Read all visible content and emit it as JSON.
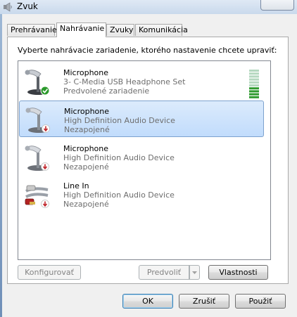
{
  "window": {
    "title": "Zvuk"
  },
  "tabs": [
    {
      "label": "Prehrávanie"
    },
    {
      "label": "Nahrávanie"
    },
    {
      "label": "Zvuky"
    },
    {
      "label": "Komunikácia"
    }
  ],
  "instruction": "Vyberte nahrávacie zariadenie, ktorého nastavenie chcete upraviť:",
  "devices": [
    {
      "name": "Microphone",
      "description": "3- C-Media USB Headphone Set",
      "status": "Predvolené zariadenie",
      "icon": "microphone-icon",
      "badge": "default-check-badge",
      "selected": false
    },
    {
      "name": "Microphone",
      "description": "High Definition Audio Device",
      "status": "Nezapojené",
      "icon": "microphone-icon",
      "badge": "unplugged-badge",
      "selected": true
    },
    {
      "name": "Microphone",
      "description": "High Definition Audio Device",
      "status": "Nezapojené",
      "icon": "microphone-icon",
      "badge": "unplugged-badge",
      "selected": false
    },
    {
      "name": "Line In",
      "description": "High Definition Audio Device",
      "status": "Nezapojené",
      "icon": "line-in-jack-icon",
      "badge": "unplugged-badge",
      "selected": false
    }
  ],
  "level_meter": {
    "segments_total": 10,
    "segments_lit": 4,
    "lit_color": "#2e9a2e",
    "unlit_color": "#b5d8c0"
  },
  "buttons": {
    "configure": "Konfigurovať",
    "set_default": "Predvoliť",
    "properties": "Vlastnosti",
    "ok": "OK",
    "cancel": "Zrušiť",
    "apply": "Použiť"
  },
  "colors": {
    "selection": "#c1dcfc",
    "accent": "#3c7fb1"
  }
}
